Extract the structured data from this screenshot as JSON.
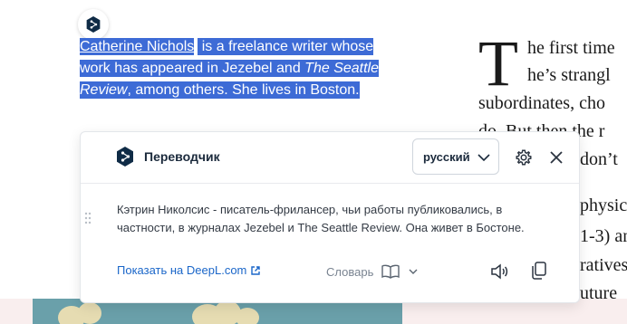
{
  "article": {
    "bio": {
      "name": "Catherine Nichols",
      "part1": " is a freelance writer whose work has appeared in Jezebel and ",
      "publication": "The Seattle Review",
      "part2": ", among others. She lives in Boston."
    },
    "drop_cap": "T",
    "column_lines": [
      "he first time",
      "he’s strangl",
      "subordinates, cho",
      "do. But then the r",
      "don’t",
      "physic",
      "1-3) an",
      "ratives",
      "uture"
    ]
  },
  "translator": {
    "title": "Переводчик",
    "language": "русский",
    "translation": "Кэтрин Николсис - писатель-фрилансер, чьи работы публиковались, в частности, в журналах Jezebel и The Seattle Review. Она живет в Бостоне.",
    "show_on_deepl": "Показать на DeepL.com",
    "dictionary": "Словарь"
  },
  "icons": {
    "deepl_logo": "deepl-logo-icon",
    "settings": "gear-icon",
    "close": "close-icon",
    "external": "external-link-icon",
    "book": "book-icon",
    "speaker": "speaker-icon",
    "copy": "copy-icon",
    "drag": "drag-handle-icon"
  },
  "colors": {
    "selection": "#3d6bd6",
    "link": "#1a66c9",
    "brand_dark": "#1b2a3c"
  }
}
